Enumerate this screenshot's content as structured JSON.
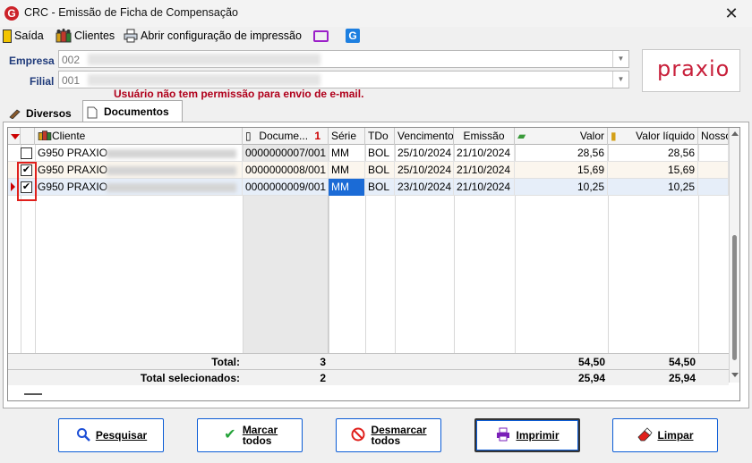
{
  "window": {
    "title": "CRC - Emissão de Ficha de Compensação",
    "app_icon_letter": "G",
    "close_glyph": "✕"
  },
  "toolbar": {
    "exit_label": "Saída",
    "clients_label": "Clientes",
    "print_config_label": "Abrir configuração de impressão",
    "g_icon_letter": "G"
  },
  "form": {
    "empresa_label": "Empresa",
    "empresa_value": "002",
    "filial_label": "Filial",
    "filial_value": "001",
    "logo_text": "praxio",
    "warning": "Usuário não tem permissão para envio de e-mail."
  },
  "tabs": [
    {
      "label": "Diversos",
      "active": false
    },
    {
      "label": "Documentos",
      "active": true
    }
  ],
  "grid": {
    "columns": [
      "Cliente",
      "Docume...",
      "Série",
      "TDo",
      "Vencimento",
      "Emissão",
      "Valor",
      "Valor líquido",
      "Nosso"
    ],
    "sort_indicator": "1",
    "rows": [
      {
        "checked": false,
        "cliente": "G950 PRAXIO",
        "documento": "0000000007/001",
        "serie": "MM",
        "tdo": "BOL",
        "vencimento": "25/10/2024",
        "emissao": "21/10/2024",
        "valor": "28,56",
        "valor_liquido": "28,56",
        "nosso": ""
      },
      {
        "checked": true,
        "cliente": "G950 PRAXIO",
        "documento": "0000000008/001",
        "serie": "MM",
        "tdo": "BOL",
        "vencimento": "25/10/2024",
        "emissao": "21/10/2024",
        "valor": "15,69",
        "valor_liquido": "15,69",
        "nosso": ""
      },
      {
        "checked": true,
        "cliente": "G950 PRAXIO",
        "documento": "0000000009/001",
        "serie": "MM",
        "tdo": "BOL",
        "vencimento": "23/10/2024",
        "emissao": "21/10/2024",
        "valor": "10,25",
        "valor_liquido": "10,25",
        "nosso": ""
      }
    ],
    "totals": {
      "total_label": "Total:",
      "total_count": "3",
      "total_valor": "54,50",
      "total_liquido": "54,50",
      "sel_label": "Total selecionados:",
      "sel_count": "2",
      "sel_valor": "25,94",
      "sel_liquido": "25,94"
    }
  },
  "buttons": {
    "pesquisar": "Pesquisar",
    "marcar_line1": "Marcar",
    "marcar_line2": "todos",
    "desmarcar_line1": "Desmarcar",
    "desmarcar_line2": "todos",
    "imprimir": "Imprimir",
    "limpar": "Limpar"
  },
  "colors": {
    "accent": "#0b5cd6",
    "warning": "#b0001b",
    "brand": "#c8203b",
    "selection": "#1b6bd6"
  }
}
